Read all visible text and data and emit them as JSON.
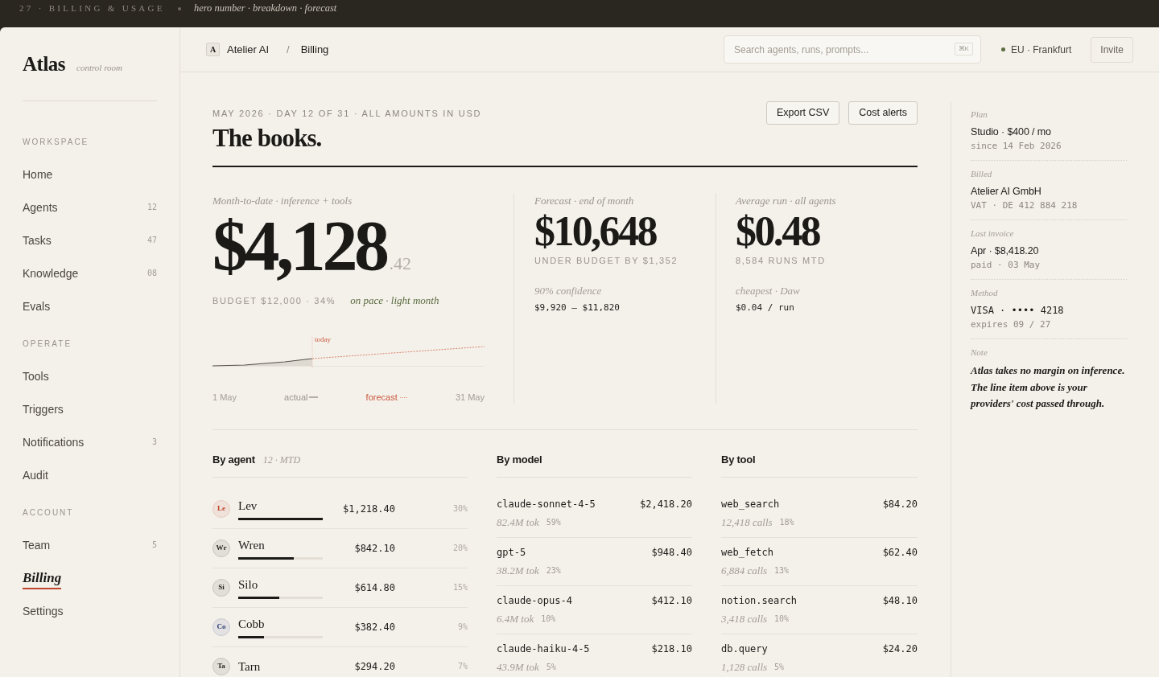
{
  "top_strip": {
    "title": "27 · BILLING & USAGE",
    "subtitle": "hero number · breakdown · forecast"
  },
  "sidebar": {
    "brand": "Atlas",
    "tagline": "control room",
    "sections": [
      {
        "label": "WORKSPACE",
        "items": [
          {
            "label": "Home",
            "selected": false
          },
          {
            "label": "Agents",
            "count": "12",
            "selected": false
          },
          {
            "label": "Tasks",
            "count": "47",
            "selected": false
          },
          {
            "label": "Knowledge",
            "count": "08",
            "selected": false
          },
          {
            "label": "Evals",
            "selected": false
          }
        ]
      },
      {
        "label": "OPERATE",
        "items": [
          {
            "label": "Tools",
            "selected": false
          },
          {
            "label": "Triggers",
            "selected": false
          },
          {
            "label": "Notifications",
            "count": "3",
            "selected": false
          },
          {
            "label": "Audit",
            "selected": false
          }
        ]
      },
      {
        "label": "ACCOUNT",
        "items": [
          {
            "label": "Team",
            "count": "5",
            "selected": false
          },
          {
            "label": "Billing",
            "selected": true
          },
          {
            "label": "Settings",
            "selected": false
          }
        ]
      }
    ]
  },
  "header": {
    "workspace_initial": "A",
    "workspace": "Atelier AI",
    "separator": "/",
    "page": "Billing",
    "search": {
      "placeholder": "Search agents, runs, prompts...",
      "shortcut": "⌘K"
    },
    "region": "EU · Frankfurt",
    "invite_button": "Invite"
  },
  "page_header": {
    "eyebrow": "MAY 2026 · DAY 12 OF 31 · ALL AMOUNTS IN USD",
    "title": "The books.",
    "actions": [
      "Export CSV",
      "Cost alerts"
    ]
  },
  "hero_stat": {
    "label": "Month-to-date · inference + tools",
    "value": "$4,128",
    "cents": ".42",
    "budget": "BUDGET $12,000 · 34%",
    "status": "on pace · light month",
    "chart": {
      "today_label": "today",
      "axis_start": "1 May",
      "axis_end": "31 May",
      "legend": [
        {
          "label": "actual",
          "kind": "actual"
        },
        {
          "label": "forecast",
          "kind": "forecast"
        }
      ]
    }
  },
  "side_stats": [
    {
      "label": "Forecast · end of month",
      "value": "$10,648",
      "note": "UNDER BUDGET BY $1,352",
      "detail_label": "90% confidence",
      "detail_value": "$9,920 — $11,820"
    },
    {
      "label": "Average run · all agents",
      "value": "$0.48",
      "note": "8,584 RUNS MTD",
      "detail_label": "cheapest · Daw",
      "detail_value": "$0.04 / run"
    }
  ],
  "by_agent": {
    "title": "By agent",
    "meta": "12 · MTD",
    "rows": [
      {
        "initials": "Le",
        "name": "Lev",
        "color": "#c0452a",
        "level": 1,
        "amount": "$1,218.40",
        "share": "30%"
      },
      {
        "initials": "Wr",
        "name": "Wren",
        "color": "#2a2620",
        "level": 0.66,
        "amount": "$842.10",
        "share": "20%"
      },
      {
        "initials": "Si",
        "name": "Silo",
        "color": "#2a2620",
        "level": 0.49,
        "amount": "$614.80",
        "share": "15%"
      },
      {
        "initials": "Co",
        "name": "Cobb",
        "color": "#34417a",
        "level": 0.3,
        "amount": "$382.40",
        "share": "9%"
      },
      {
        "initials": "Ta",
        "name": "Tarn",
        "color": "#2a2620",
        "amount": "$294.20",
        "share": "7%"
      }
    ]
  },
  "by_model": {
    "title": "By model",
    "rows": [
      {
        "name": "claude-sonnet-4-5",
        "amount": "$2,418.20",
        "usage": "82.4M tok",
        "share": "59%"
      },
      {
        "name": "gpt-5",
        "amount": "$948.40",
        "usage": "38.2M tok",
        "share": "23%"
      },
      {
        "name": "claude-opus-4",
        "amount": "$412.10",
        "usage": "6.4M tok",
        "share": "10%"
      },
      {
        "name": "claude-haiku-4-5",
        "amount": "$218.10",
        "usage": "43.9M tok",
        "share": "5%"
      }
    ]
  },
  "by_tool": {
    "title": "By tool",
    "rows": [
      {
        "name": "web_search",
        "amount": "$84.20",
        "usage": "12,418 calls",
        "share": "18%"
      },
      {
        "name": "web_fetch",
        "amount": "$62.40",
        "usage": "6,884 calls",
        "share": "13%"
      },
      {
        "name": "notion.search",
        "amount": "$48.10",
        "usage": "3,418 calls",
        "share": "10%"
      },
      {
        "name": "db.query",
        "amount": "$24.20",
        "usage": "1,128 calls",
        "share": "5%"
      }
    ]
  },
  "account_panel": {
    "sections": [
      {
        "label": "Plan",
        "value": "Studio · $400 / mo",
        "detail": "since 14 Feb 2026",
        "kind": "text"
      },
      {
        "label": "Billed",
        "value": "Atelier AI GmbH",
        "detail": "VAT · DE 412 884 218",
        "kind": "text"
      },
      {
        "label": "Last invoice",
        "value": "Apr · $8,418.20",
        "detail": "paid · 03 May",
        "kind": "text"
      },
      {
        "label": "Method",
        "value": "VISA · •••• 4218",
        "detail": "expires 09 / 27",
        "kind": "mono"
      }
    ],
    "note": {
      "label": "Note",
      "text": "Atlas takes no margin on inference. The line item above is your providers' cost passed through."
    }
  }
}
